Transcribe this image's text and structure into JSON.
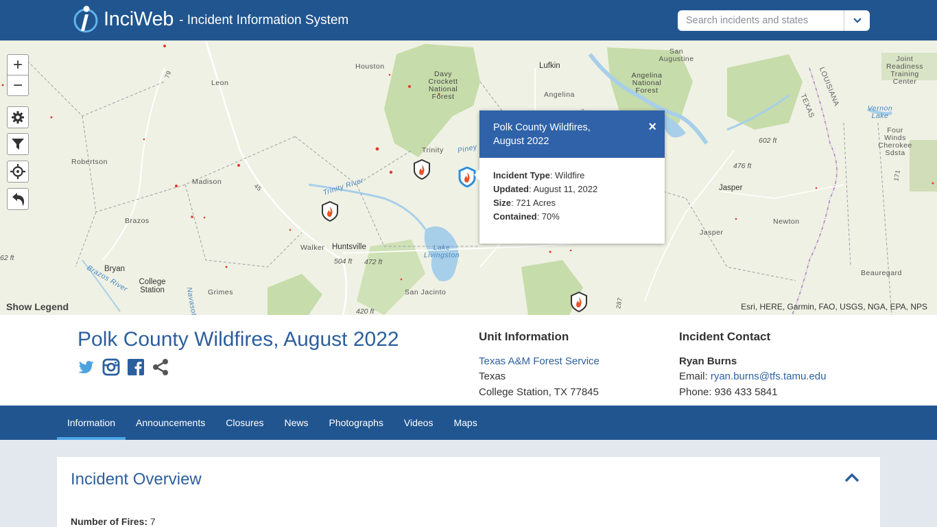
{
  "header": {
    "logo_name": "InciWeb",
    "logo_subtitle": "- Incident Information System",
    "search_placeholder": "Search incidents and states"
  },
  "map": {
    "controls": [
      "zoom-in",
      "zoom-out",
      "settings",
      "filter",
      "locate",
      "back"
    ],
    "zoom_in": "+",
    "zoom_out": "−",
    "show_legend": "Show Legend",
    "attribution": "Esri, HERE, Garmin, FAO, USGS, NGA, EPA, NPS",
    "labels": [
      "Houston",
      "Leon",
      "Robertson",
      "Madison",
      "Brazos",
      "Bryan",
      "College Station",
      "Grimes",
      "Walker",
      "Huntsville",
      "San Jacinto",
      "Trinity",
      "Trinity River",
      "Lake Livingston",
      "Davy Crockett National Forest",
      "Lufkin",
      "Angelina",
      "Angelina National Forest",
      "San Augustine",
      "Jasper",
      "Newton",
      "Beauregard",
      "Vernon Lake",
      "Four Winds Cherokee Sdsta",
      "Joint Readiness Training Center",
      "LOUISIANA",
      "TEXAS",
      "Brazos River",
      "Navasota",
      "Piney",
      "62 ft",
      "504 ft",
      "472 ft",
      "420 ft",
      "602 ft",
      "476 ft",
      "79",
      "45",
      "287",
      "171"
    ],
    "accent": "#2f62a8"
  },
  "popup": {
    "title": "Polk County Wildfires, August 2022",
    "close": "×",
    "fields": [
      {
        "label": "Incident Type",
        "value": ": Wildfire"
      },
      {
        "label": "Updated",
        "value": ": August 11, 2022"
      },
      {
        "label": "Size",
        "value": ": 721 Acres"
      },
      {
        "label": "Contained",
        "value": ": 70%"
      }
    ]
  },
  "incident": {
    "title": "Polk County Wildfires, August 2022",
    "social": [
      "twitter-icon",
      "instagram-icon",
      "facebook-icon",
      "share-icon"
    ]
  },
  "unit_info": {
    "heading": "Unit Information",
    "agency": "Texas A&M Forest Service",
    "state": "Texas",
    "address": "College Station, TX 77845"
  },
  "contact": {
    "heading": "Incident Contact",
    "name": "Ryan Burns",
    "email_label": "Email: ",
    "email": "ryan.burns@tfs.tamu.edu",
    "phone": "Phone: 936 433 5841"
  },
  "tabs": [
    {
      "label": "Information",
      "active": true
    },
    {
      "label": "Announcements"
    },
    {
      "label": "Closures"
    },
    {
      "label": "News"
    },
    {
      "label": "Photographs"
    },
    {
      "label": "Videos"
    },
    {
      "label": "Maps"
    }
  ],
  "overview": {
    "title": "Incident Overview",
    "fires_label": "Number of Fires:",
    "fires_value": " 7"
  },
  "colors": {
    "header": "#21558f",
    "link": "#2c5f9e",
    "tab_underline": "#4ea6e8"
  }
}
